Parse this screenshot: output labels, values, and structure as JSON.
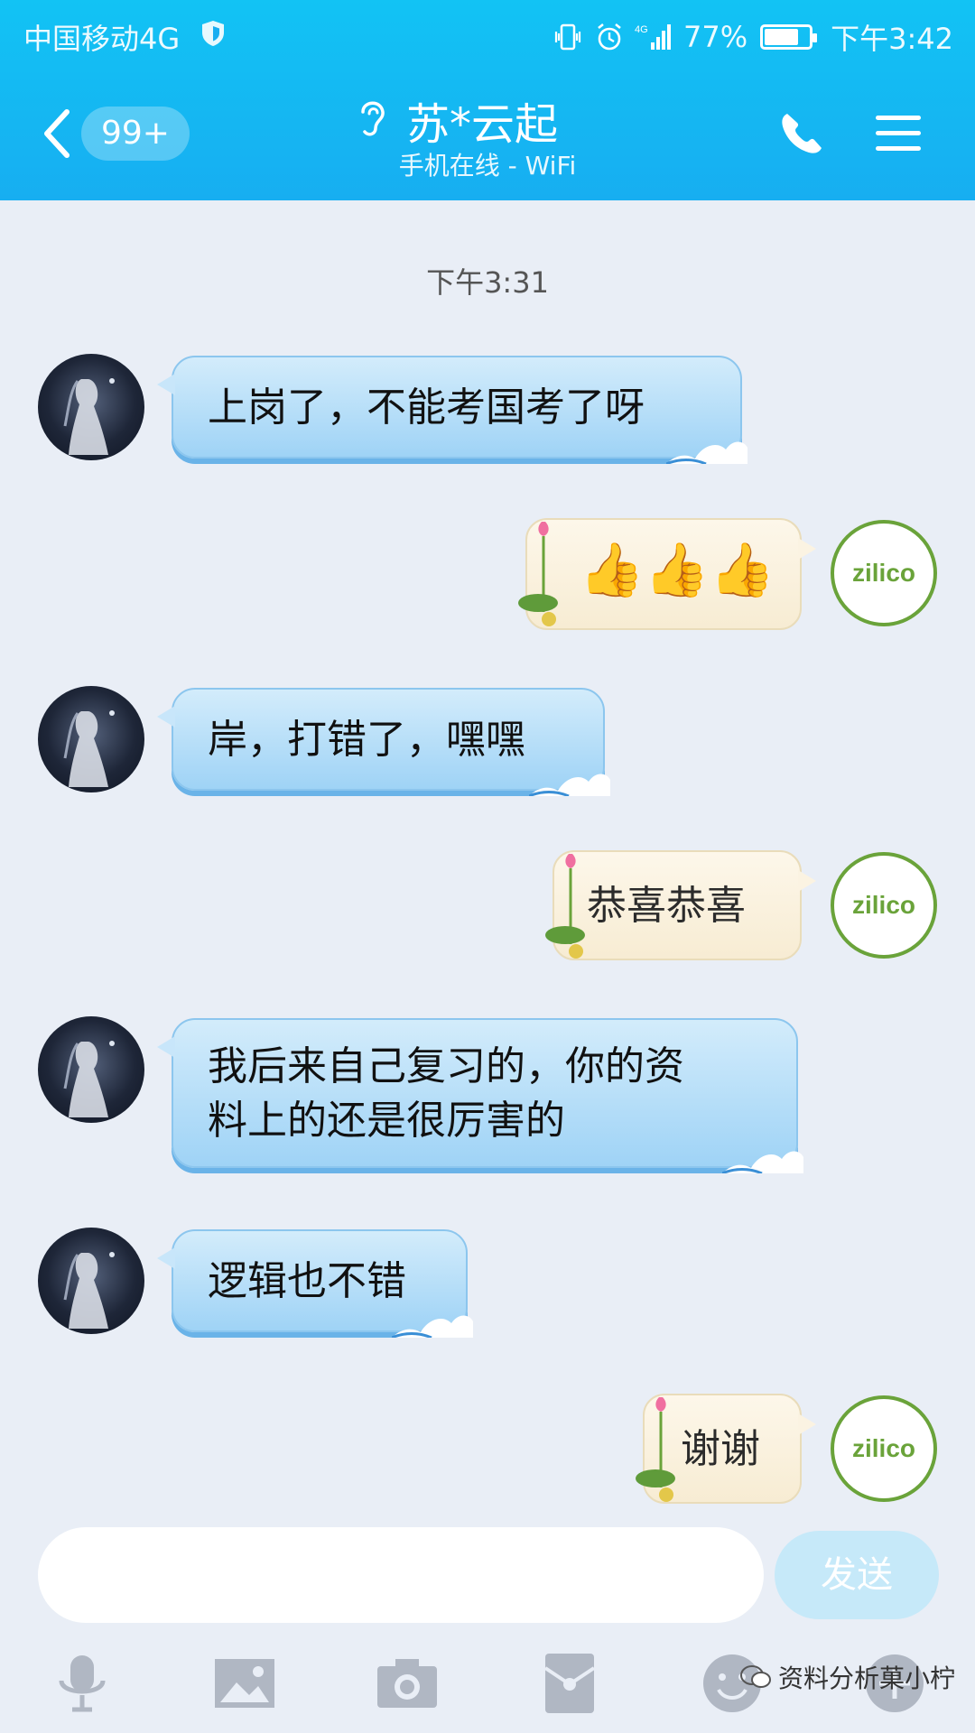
{
  "status_bar": {
    "carrier": "中国移动4G",
    "network": "4G",
    "battery": "77%",
    "battery_level": 0.77,
    "time": "下午3:42"
  },
  "header": {
    "unread_count": "99+",
    "contact_name": "苏*云起",
    "contact_status": "手机在线 - WiFi",
    "accent_color": "#12c3f4"
  },
  "chat": {
    "timestamp": "下午3:31",
    "messages": [
      {
        "side": "in",
        "text": "上岗了，不能考国考了呀"
      },
      {
        "side": "out",
        "text": "👍👍👍"
      },
      {
        "side": "in",
        "text": "岸，打错了，嘿嘿"
      },
      {
        "side": "out",
        "text": "恭喜恭喜"
      },
      {
        "side": "in",
        "text_line1": "我后来自己复习的，你的资",
        "text_line2": "料上的还是很厉害的"
      },
      {
        "side": "in",
        "text": "逻辑也不错"
      },
      {
        "side": "out",
        "text": "谢谢"
      }
    ],
    "self_avatar_text": "zilico"
  },
  "input": {
    "placeholder": "",
    "send_label": "发送"
  },
  "toolbar": {
    "items": [
      "mic-icon",
      "image-icon",
      "camera-icon",
      "red-packet-icon",
      "emoji-icon",
      "plus-icon"
    ]
  },
  "watermark": "资料分析菓小柠"
}
